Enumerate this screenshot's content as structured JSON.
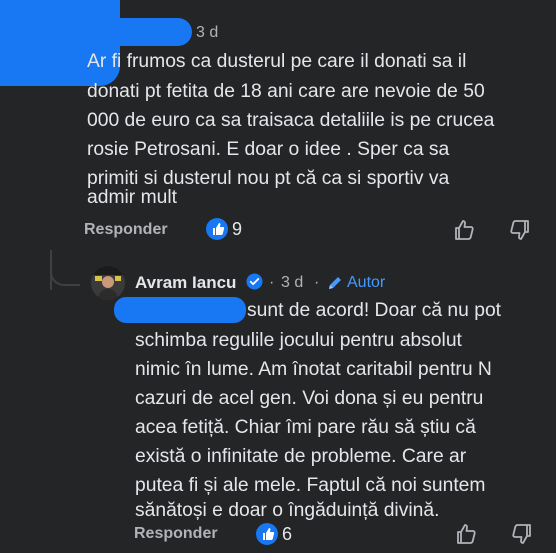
{
  "comment1": {
    "time": "3 d",
    "text_lines": [
      "Ar fi frumos ca dusterul pe care il donati  sa il",
      "donati pt fetita  de 18  ani care are nevoie de 50",
      "000 de euro ca sa traisaca detaliile is pe crucea",
      "rosie Petrosani. E doar o idee . Sper ca sa",
      "primiti si dusterul nou pt că ca si sportiv va",
      "admir mult"
    ],
    "reply_label": "Responder",
    "like_count": "9",
    "icons": {
      "like": "like-icon",
      "dislike": "dislike-icon"
    }
  },
  "comment2": {
    "author": "Avram Iancu",
    "time": "3 d",
    "separator": "·",
    "badge": "Autor",
    "text_first": "sunt de acord! Doar că nu pot",
    "text_lines": [
      "schimba regulile jocului pentru absolut",
      "nimic în lume. Am înotat caritabil pentru N",
      "cazuri de acel gen. Voi dona și eu pentru",
      "acea fetiță. Chiar îmi pare rău să știu că",
      "există o infinitate de probleme. Care ar",
      "putea fi și ale mele. Faptul că noi suntem",
      "sănătoși e doar o îngăduință divină."
    ],
    "reply_label": "Responder",
    "like_count": "6",
    "icons": {
      "verified": "verified-badge-icon",
      "pencil": "pencil-icon",
      "like": "like-icon",
      "dislike": "dislike-icon"
    }
  },
  "colors": {
    "background": "#242526",
    "text": "#e4e6eb",
    "muted": "#b0b3b8",
    "accent": "#1877f2"
  }
}
